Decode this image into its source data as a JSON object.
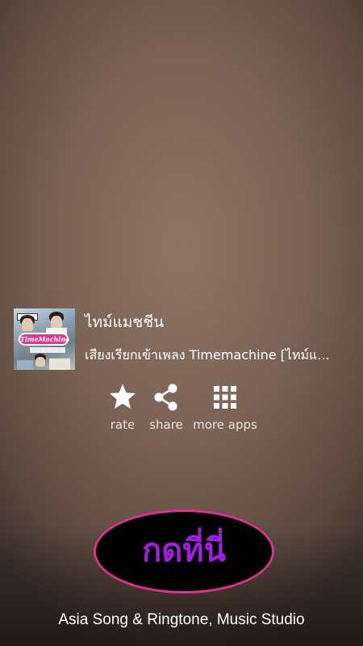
{
  "song": {
    "title": "ไทม์แมชชีน",
    "subtitle": "เสียงเรียกเข้าเพลง Timemachine [ไทม์แ...",
    "album_art_logo": "TimeMachine"
  },
  "actions": {
    "rate": {
      "label": "rate",
      "icon": "star-icon"
    },
    "share": {
      "label": "share",
      "icon": "share-icon"
    },
    "more_apps": {
      "label": "more apps",
      "icon": "grid-icon"
    }
  },
  "cta": {
    "label": "กดที่นี่",
    "text_color": "#a020e0",
    "border_color": "#d8338f"
  },
  "footer": {
    "text": "Asia Song & Ringtone, Music Studio"
  }
}
